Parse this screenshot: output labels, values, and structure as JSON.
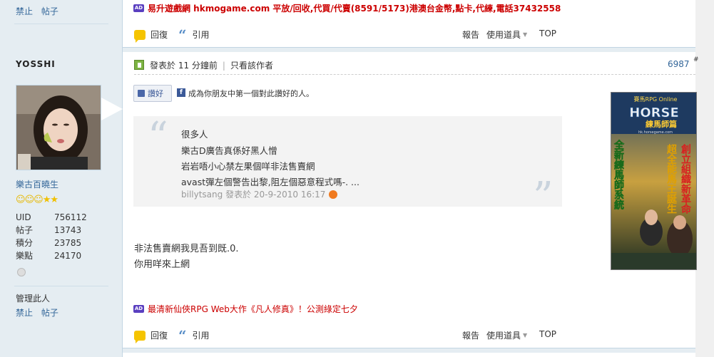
{
  "sidebar": {
    "top_links": [
      "禁止",
      "帖子"
    ],
    "username": "YOSSHI",
    "usergroup": "樂古百曉生",
    "rank_icons": [
      "smile",
      "smile",
      "smile",
      "star",
      "star"
    ],
    "stats": [
      {
        "key": "UID",
        "value": "756112"
      },
      {
        "key": "帖子",
        "value": "13743"
      },
      {
        "key": "積分",
        "value": "23785"
      },
      {
        "key": "樂點",
        "value": "24170"
      }
    ],
    "manage_label": "管理此人",
    "bottom_links": [
      "禁止",
      "帖子"
    ]
  },
  "top_ad": {
    "badge": "AD",
    "text": "易升遊戲網 hkmogame.com 平放/回收,代買/代賣(8591/5173)港澳台金幣,點卡,代練,電話37432558"
  },
  "actionbar": {
    "reply": "回復",
    "quote": "引用",
    "report": "報告",
    "tools": "使用道具",
    "top": "TOP"
  },
  "post": {
    "posted_at": "發表於 11 分鐘前",
    "only_author": "只看該作者",
    "floor": "6987",
    "floor_sup": "#",
    "like_button": "讚好",
    "fb_text": "成為你朋友中第一個對此讚好的人。",
    "quote": {
      "lines": [
        "很多人",
        "樂古D廣告真係好黑人憎",
        "岩岩唔小心禁左果個咩非法售賣網",
        "avast彈左個警告出黎,阻左個惡意程式嗎-. ..."
      ],
      "author": "billytsang",
      "posted": "發表於 20-9-2010 16:17"
    },
    "body_lines": [
      "非法售賣網我見吾到既.0.",
      "你用咩來上網"
    ]
  },
  "bottom_ad": {
    "badge": "AD",
    "text": "最清新仙俠RPG Web大作《凡人修真》！公測綠定七夕"
  },
  "banner": {
    "brand": "賽馬RPG Online",
    "logo": "HORSE",
    "title_jp": "練馬師篇",
    "url": "hk.horsegame.com",
    "slogan_1": "創立組織新革命",
    "slogan_2": "超全能馬王誕生",
    "slogan_3": "全新練馬師系統"
  },
  "colors": {
    "sidebar_bg": "#e5edf2",
    "link_blue": "#336699",
    "ad_red": "#cc0000"
  }
}
